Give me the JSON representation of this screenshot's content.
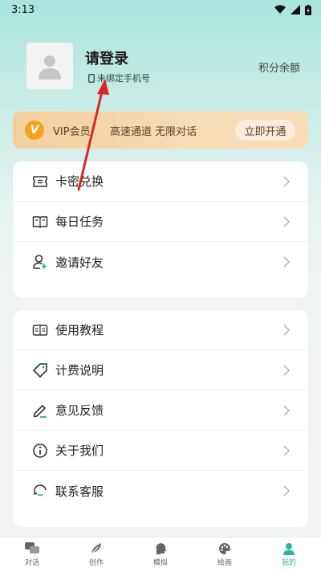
{
  "status_bar": {
    "time": "3:13"
  },
  "profile": {
    "login_title": "请登录",
    "phone_badge": "未绑定手机号",
    "points_label": "积分余额"
  },
  "vip": {
    "logo_letter": "V",
    "label": "VIP会员",
    "desc": "高速通道 无限对话",
    "button": "立即开通"
  },
  "menu_group1": [
    {
      "label": "卡密兑换",
      "icon": "ticket-icon"
    },
    {
      "label": "每日任务",
      "icon": "book-icon"
    },
    {
      "label": "邀请好友",
      "icon": "add-user-icon"
    }
  ],
  "menu_group2": [
    {
      "label": "使用教程",
      "icon": "tutorial-icon"
    },
    {
      "label": "计费说明",
      "icon": "tag-icon"
    },
    {
      "label": "意见反馈",
      "icon": "pen-icon"
    },
    {
      "label": "关于我们",
      "icon": "info-icon"
    },
    {
      "label": "联系客服",
      "icon": "customer-service-icon"
    }
  ],
  "tabs": [
    {
      "label": "对话",
      "icon": "chat-icon"
    },
    {
      "label": "创作",
      "icon": "feather-icon"
    },
    {
      "label": "模拟",
      "icon": "head-icon"
    },
    {
      "label": "绘画",
      "icon": "palette-icon"
    },
    {
      "label": "我的",
      "icon": "user-icon"
    }
  ],
  "colors": {
    "accent": "#2bb5a5",
    "vip_gold": "#f0a419",
    "annotation": "#d9262b"
  }
}
